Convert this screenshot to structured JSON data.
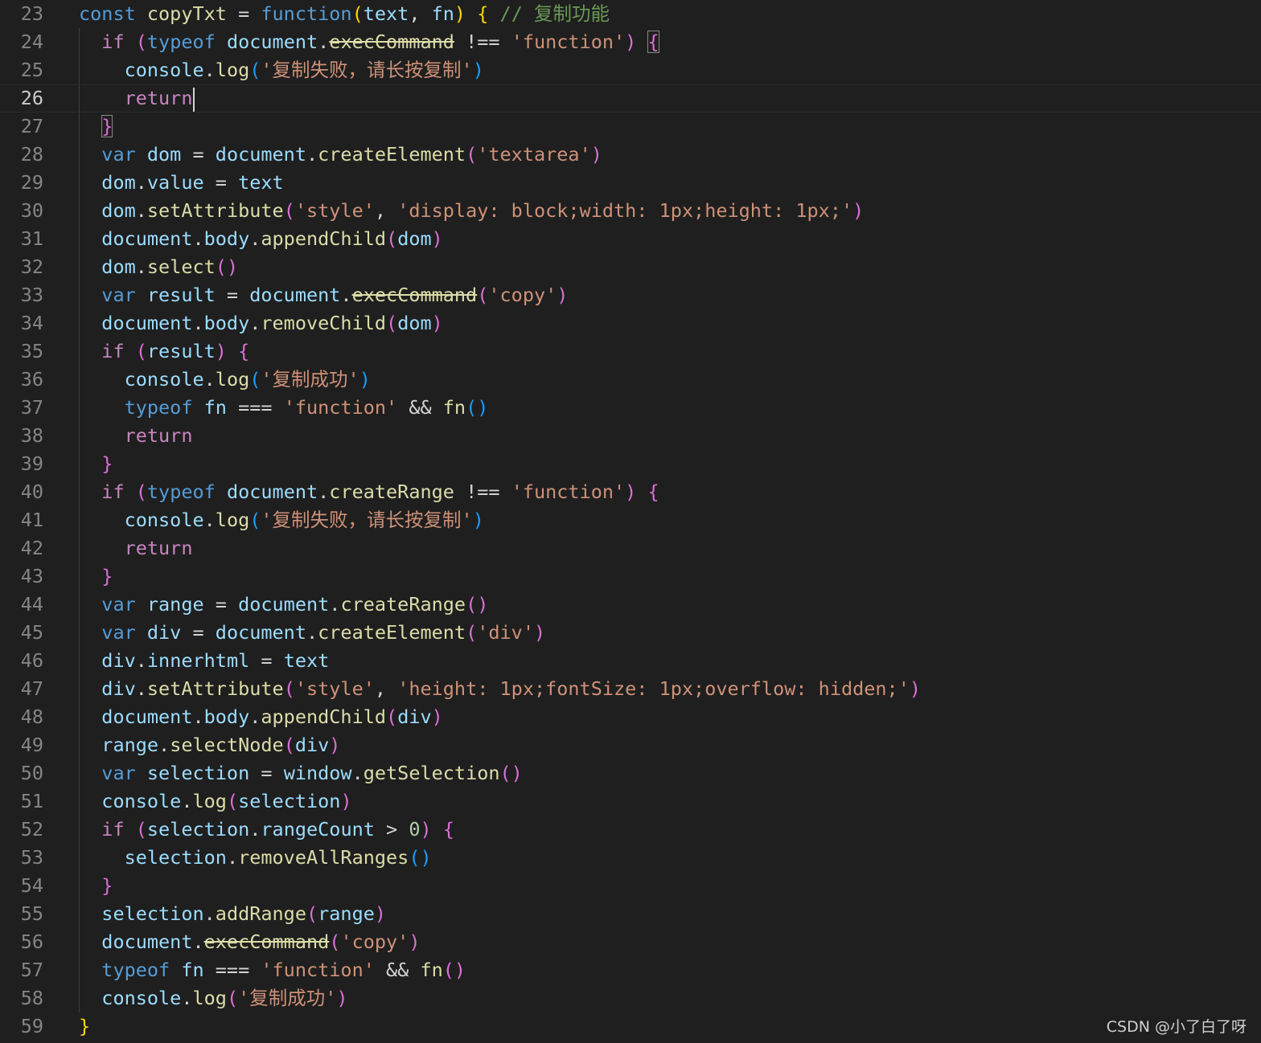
{
  "editor": {
    "language": "javascript",
    "active_line": 26,
    "lines": [
      {
        "n": "23",
        "code": [
          [
            "kw",
            "const "
          ],
          [
            "fn",
            "copyTxt"
          ],
          [
            "op",
            " = "
          ],
          [
            "kw",
            "function"
          ],
          [
            "b1",
            "("
          ],
          [
            "id",
            "text"
          ],
          [
            "op",
            ", "
          ],
          [
            "id",
            "fn"
          ],
          [
            "b1",
            ")"
          ],
          [
            "op",
            " "
          ],
          [
            "b1",
            "{"
          ],
          [
            "op",
            " "
          ],
          [
            "cm",
            "// 复制功能"
          ]
        ]
      },
      {
        "n": "24",
        "code": [
          [
            "op",
            "  "
          ],
          [
            "ctl",
            "if "
          ],
          [
            "b2",
            "("
          ],
          [
            "kw",
            "typeof "
          ],
          [
            "id",
            "document"
          ],
          [
            "op",
            "."
          ],
          [
            "fn",
            "execCommand",
            "strike"
          ],
          [
            "op",
            " !== "
          ],
          [
            "str",
            "'function'"
          ],
          [
            "b2",
            ")"
          ],
          [
            "op",
            " "
          ],
          [
            "b2",
            "{",
            "boxed"
          ]
        ]
      },
      {
        "n": "25",
        "code": [
          [
            "op",
            "    "
          ],
          [
            "id",
            "console"
          ],
          [
            "op",
            "."
          ],
          [
            "fn",
            "log"
          ],
          [
            "b3",
            "("
          ],
          [
            "str",
            "'复制失败，请长按复制'"
          ],
          [
            "b3",
            ")"
          ]
        ]
      },
      {
        "n": "26",
        "code": [
          [
            "op",
            "    "
          ],
          [
            "ctl",
            "return"
          ],
          [
            "cursor",
            ""
          ]
        ]
      },
      {
        "n": "27",
        "code": [
          [
            "op",
            "  "
          ],
          [
            "b2",
            "}",
            "boxed"
          ]
        ]
      },
      {
        "n": "28",
        "code": [
          [
            "op",
            "  "
          ],
          [
            "kw",
            "var "
          ],
          [
            "id",
            "dom"
          ],
          [
            "op",
            " = "
          ],
          [
            "id",
            "document"
          ],
          [
            "op",
            "."
          ],
          [
            "fn",
            "createElement"
          ],
          [
            "b2",
            "("
          ],
          [
            "str",
            "'textarea'"
          ],
          [
            "b2",
            ")"
          ]
        ]
      },
      {
        "n": "29",
        "code": [
          [
            "op",
            "  "
          ],
          [
            "id",
            "dom"
          ],
          [
            "op",
            "."
          ],
          [
            "id",
            "value"
          ],
          [
            "op",
            " = "
          ],
          [
            "id",
            "text"
          ]
        ]
      },
      {
        "n": "30",
        "code": [
          [
            "op",
            "  "
          ],
          [
            "id",
            "dom"
          ],
          [
            "op",
            "."
          ],
          [
            "fn",
            "setAttribute"
          ],
          [
            "b2",
            "("
          ],
          [
            "str",
            "'style'"
          ],
          [
            "op",
            ", "
          ],
          [
            "str",
            "'display: block;width: 1px;height: 1px;'"
          ],
          [
            "b2",
            ")"
          ]
        ]
      },
      {
        "n": "31",
        "code": [
          [
            "op",
            "  "
          ],
          [
            "id",
            "document"
          ],
          [
            "op",
            "."
          ],
          [
            "id",
            "body"
          ],
          [
            "op",
            "."
          ],
          [
            "fn",
            "appendChild"
          ],
          [
            "b2",
            "("
          ],
          [
            "id",
            "dom"
          ],
          [
            "b2",
            ")"
          ]
        ]
      },
      {
        "n": "32",
        "code": [
          [
            "op",
            "  "
          ],
          [
            "id",
            "dom"
          ],
          [
            "op",
            "."
          ],
          [
            "fn",
            "select"
          ],
          [
            "b2",
            "()"
          ]
        ]
      },
      {
        "n": "33",
        "code": [
          [
            "op",
            "  "
          ],
          [
            "kw",
            "var "
          ],
          [
            "id",
            "result"
          ],
          [
            "op",
            " = "
          ],
          [
            "id",
            "document"
          ],
          [
            "op",
            "."
          ],
          [
            "fn",
            "execCommand",
            "strike"
          ],
          [
            "b2",
            "("
          ],
          [
            "str",
            "'copy'"
          ],
          [
            "b2",
            ")"
          ]
        ]
      },
      {
        "n": "34",
        "code": [
          [
            "op",
            "  "
          ],
          [
            "id",
            "document"
          ],
          [
            "op",
            "."
          ],
          [
            "id",
            "body"
          ],
          [
            "op",
            "."
          ],
          [
            "fn",
            "removeChild"
          ],
          [
            "b2",
            "("
          ],
          [
            "id",
            "dom"
          ],
          [
            "b2",
            ")"
          ]
        ]
      },
      {
        "n": "35",
        "code": [
          [
            "op",
            "  "
          ],
          [
            "ctl",
            "if "
          ],
          [
            "b2",
            "("
          ],
          [
            "id",
            "result"
          ],
          [
            "b2",
            ")"
          ],
          [
            "op",
            " "
          ],
          [
            "b2",
            "{"
          ]
        ]
      },
      {
        "n": "36",
        "code": [
          [
            "op",
            "    "
          ],
          [
            "id",
            "console"
          ],
          [
            "op",
            "."
          ],
          [
            "fn",
            "log"
          ],
          [
            "b3",
            "("
          ],
          [
            "str",
            "'复制成功'"
          ],
          [
            "b3",
            ")"
          ]
        ]
      },
      {
        "n": "37",
        "code": [
          [
            "op",
            "    "
          ],
          [
            "kw",
            "typeof "
          ],
          [
            "id",
            "fn"
          ],
          [
            "op",
            " === "
          ],
          [
            "str",
            "'function'"
          ],
          [
            "op",
            " && "
          ],
          [
            "fn",
            "fn"
          ],
          [
            "b3",
            "()"
          ]
        ]
      },
      {
        "n": "38",
        "code": [
          [
            "op",
            "    "
          ],
          [
            "ctl",
            "return"
          ]
        ]
      },
      {
        "n": "39",
        "code": [
          [
            "op",
            "  "
          ],
          [
            "b2",
            "}"
          ]
        ]
      },
      {
        "n": "40",
        "code": [
          [
            "op",
            "  "
          ],
          [
            "ctl",
            "if "
          ],
          [
            "b2",
            "("
          ],
          [
            "kw",
            "typeof "
          ],
          [
            "id",
            "document"
          ],
          [
            "op",
            "."
          ],
          [
            "fn",
            "createRange"
          ],
          [
            "op",
            " !== "
          ],
          [
            "str",
            "'function'"
          ],
          [
            "b2",
            ")"
          ],
          [
            "op",
            " "
          ],
          [
            "b2",
            "{"
          ]
        ]
      },
      {
        "n": "41",
        "code": [
          [
            "op",
            "    "
          ],
          [
            "id",
            "console"
          ],
          [
            "op",
            "."
          ],
          [
            "fn",
            "log"
          ],
          [
            "b3",
            "("
          ],
          [
            "str",
            "'复制失败，请长按复制'"
          ],
          [
            "b3",
            ")"
          ]
        ]
      },
      {
        "n": "42",
        "code": [
          [
            "op",
            "    "
          ],
          [
            "ctl",
            "return"
          ]
        ]
      },
      {
        "n": "43",
        "code": [
          [
            "op",
            "  "
          ],
          [
            "b2",
            "}"
          ]
        ]
      },
      {
        "n": "44",
        "code": [
          [
            "op",
            "  "
          ],
          [
            "kw",
            "var "
          ],
          [
            "id",
            "range"
          ],
          [
            "op",
            " = "
          ],
          [
            "id",
            "document"
          ],
          [
            "op",
            "."
          ],
          [
            "fn",
            "createRange"
          ],
          [
            "b2",
            "()"
          ]
        ]
      },
      {
        "n": "45",
        "code": [
          [
            "op",
            "  "
          ],
          [
            "kw",
            "var "
          ],
          [
            "id",
            "div"
          ],
          [
            "op",
            " = "
          ],
          [
            "id",
            "document"
          ],
          [
            "op",
            "."
          ],
          [
            "fn",
            "createElement"
          ],
          [
            "b2",
            "("
          ],
          [
            "str",
            "'div'"
          ],
          [
            "b2",
            ")"
          ]
        ]
      },
      {
        "n": "46",
        "code": [
          [
            "op",
            "  "
          ],
          [
            "id",
            "div"
          ],
          [
            "op",
            "."
          ],
          [
            "id",
            "innerhtml"
          ],
          [
            "op",
            " = "
          ],
          [
            "id",
            "text"
          ]
        ]
      },
      {
        "n": "47",
        "code": [
          [
            "op",
            "  "
          ],
          [
            "id",
            "div"
          ],
          [
            "op",
            "."
          ],
          [
            "fn",
            "setAttribute"
          ],
          [
            "b2",
            "("
          ],
          [
            "str",
            "'style'"
          ],
          [
            "op",
            ", "
          ],
          [
            "str",
            "'height: 1px;fontSize: 1px;overflow: hidden;'"
          ],
          [
            "b2",
            ")"
          ]
        ]
      },
      {
        "n": "48",
        "code": [
          [
            "op",
            "  "
          ],
          [
            "id",
            "document"
          ],
          [
            "op",
            "."
          ],
          [
            "id",
            "body"
          ],
          [
            "op",
            "."
          ],
          [
            "fn",
            "appendChild"
          ],
          [
            "b2",
            "("
          ],
          [
            "id",
            "div"
          ],
          [
            "b2",
            ")"
          ]
        ]
      },
      {
        "n": "49",
        "code": [
          [
            "op",
            "  "
          ],
          [
            "id",
            "range"
          ],
          [
            "op",
            "."
          ],
          [
            "fn",
            "selectNode"
          ],
          [
            "b2",
            "("
          ],
          [
            "id",
            "div"
          ],
          [
            "b2",
            ")"
          ]
        ]
      },
      {
        "n": "50",
        "code": [
          [
            "op",
            "  "
          ],
          [
            "kw",
            "var "
          ],
          [
            "id",
            "selection"
          ],
          [
            "op",
            " = "
          ],
          [
            "id",
            "window"
          ],
          [
            "op",
            "."
          ],
          [
            "fn",
            "getSelection"
          ],
          [
            "b2",
            "()"
          ]
        ]
      },
      {
        "n": "51",
        "code": [
          [
            "op",
            "  "
          ],
          [
            "id",
            "console"
          ],
          [
            "op",
            "."
          ],
          [
            "fn",
            "log"
          ],
          [
            "b2",
            "("
          ],
          [
            "id",
            "selection"
          ],
          [
            "b2",
            ")"
          ]
        ]
      },
      {
        "n": "52",
        "code": [
          [
            "op",
            "  "
          ],
          [
            "ctl",
            "if "
          ],
          [
            "b2",
            "("
          ],
          [
            "id",
            "selection"
          ],
          [
            "op",
            "."
          ],
          [
            "id",
            "rangeCount"
          ],
          [
            "op",
            " > "
          ],
          [
            "num",
            "0"
          ],
          [
            "b2",
            ")"
          ],
          [
            "op",
            " "
          ],
          [
            "b2",
            "{"
          ]
        ]
      },
      {
        "n": "53",
        "code": [
          [
            "op",
            "    "
          ],
          [
            "id",
            "selection"
          ],
          [
            "op",
            "."
          ],
          [
            "fn",
            "removeAllRanges"
          ],
          [
            "b3",
            "()"
          ]
        ]
      },
      {
        "n": "54",
        "code": [
          [
            "op",
            "  "
          ],
          [
            "b2",
            "}"
          ]
        ]
      },
      {
        "n": "55",
        "code": [
          [
            "op",
            "  "
          ],
          [
            "id",
            "selection"
          ],
          [
            "op",
            "."
          ],
          [
            "fn",
            "addRange"
          ],
          [
            "b2",
            "("
          ],
          [
            "id",
            "range"
          ],
          [
            "b2",
            ")"
          ]
        ]
      },
      {
        "n": "56",
        "code": [
          [
            "op",
            "  "
          ],
          [
            "id",
            "document"
          ],
          [
            "op",
            "."
          ],
          [
            "fn",
            "execCommand",
            "strike"
          ],
          [
            "b2",
            "("
          ],
          [
            "str",
            "'copy'"
          ],
          [
            "b2",
            ")"
          ]
        ]
      },
      {
        "n": "57",
        "code": [
          [
            "op",
            "  "
          ],
          [
            "kw",
            "typeof "
          ],
          [
            "id",
            "fn"
          ],
          [
            "op",
            " === "
          ],
          [
            "str",
            "'function'"
          ],
          [
            "op",
            " && "
          ],
          [
            "fn",
            "fn"
          ],
          [
            "b2",
            "()"
          ]
        ]
      },
      {
        "n": "58",
        "code": [
          [
            "op",
            "  "
          ],
          [
            "id",
            "console"
          ],
          [
            "op",
            "."
          ],
          [
            "fn",
            "log"
          ],
          [
            "b2",
            "("
          ],
          [
            "str",
            "'复制成功'"
          ],
          [
            "b2",
            ")"
          ]
        ]
      },
      {
        "n": "59",
        "code": [
          [
            "b1",
            "}"
          ]
        ]
      }
    ]
  },
  "watermark": "CSDN @小了白了呀",
  "colors": {
    "background": "#1f1f1f",
    "keyword": "#569cd6",
    "control": "#c586c0",
    "identifier": "#9cdcfe",
    "function": "#dcdcaa",
    "string": "#ce9178",
    "number": "#b5cea8",
    "comment": "#6a9955",
    "bracket_level1": "#ffd700",
    "bracket_level2": "#da70d6",
    "bracket_level3": "#179fff"
  }
}
